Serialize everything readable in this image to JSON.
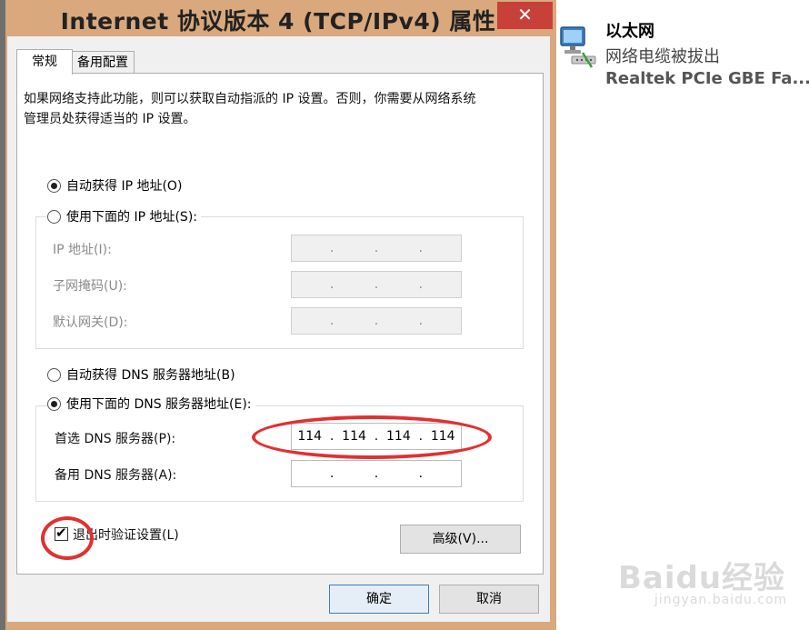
{
  "window": {
    "title": "Internet 协议版本 4 (TCP/IPv4) 属性",
    "close_glyph": "✕"
  },
  "tabs": [
    {
      "label": "常规",
      "active": true
    },
    {
      "label": "备用配置",
      "active": false
    }
  ],
  "description": "如果网络支持此功能，则可以获取自动指派的 IP 设置。否则，你需要从网络系统管理员处获得适当的 IP 设置。",
  "ip_section": {
    "auto_label": "自动获得 IP 地址(O)",
    "auto_checked": true,
    "manual_label": "使用下面的 IP 地址(S):",
    "manual_checked": false,
    "fields": [
      {
        "label": "IP 地址(I):",
        "value": [
          "",
          "",
          "",
          ""
        ]
      },
      {
        "label": "子网掩码(U):",
        "value": [
          "",
          "",
          "",
          ""
        ]
      },
      {
        "label": "默认网关(D):",
        "value": [
          "",
          "",
          "",
          ""
        ]
      }
    ]
  },
  "dns_section": {
    "auto_label": "自动获得 DNS 服务器地址(B)",
    "auto_checked": false,
    "manual_label": "使用下面的 DNS 服务器地址(E):",
    "manual_checked": true,
    "preferred": {
      "label": "首选 DNS 服务器(P):",
      "octets": [
        "114",
        "114",
        "114",
        "114"
      ]
    },
    "alternate": {
      "label": "备用 DNS 服务器(A):",
      "octets": [
        "",
        "",
        "",
        ""
      ]
    }
  },
  "validate": {
    "label": "退出时验证设置(L)",
    "checked": true
  },
  "buttons": {
    "advanced": "高级(V)...",
    "ok": "确定",
    "cancel": "取消"
  },
  "annotation_color": "#e23030",
  "notification": {
    "icon": "network-computer-icon",
    "title": "以太网",
    "status": "网络电缆被拔出",
    "adapter": "Realtek PCIe GBE Fa..."
  },
  "watermark": {
    "main": "Baidu经验",
    "sub": "jingyan.baidu.com"
  }
}
